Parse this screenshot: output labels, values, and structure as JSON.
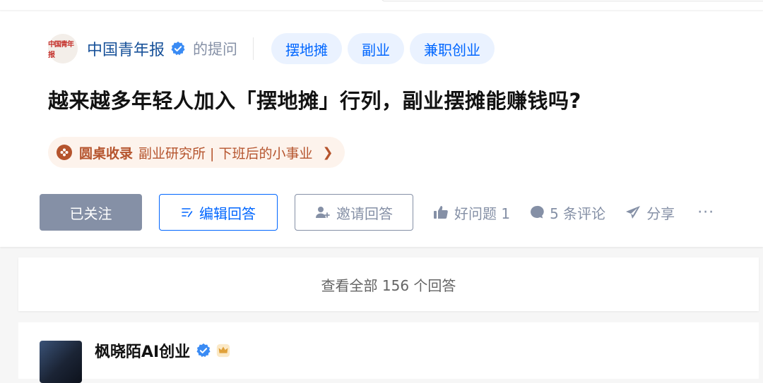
{
  "question": {
    "asker": {
      "avatar_text": "中国青年报",
      "name": "中国青年报",
      "suffix": "的提问"
    },
    "tags": [
      "摆地摊",
      "副业",
      "兼职创业"
    ],
    "title": "越来越多年轻人加入「摆地摊」行列，副业摆摊能赚钱吗?",
    "roundtable": {
      "label": "圆桌收录",
      "description": "副业研究所 | 下班后的小事业",
      "chevron": "❯"
    }
  },
  "actions": {
    "follow_label": "已关注",
    "edit_label": "编辑回答",
    "invite_label": "邀请回答",
    "good_question_label": "好问题 1",
    "comments_label": "5 条评论",
    "share_label": "分享",
    "more_label": "···"
  },
  "view_all_label": "查看全部 156 个回答",
  "answer": {
    "author": "枫晓陌AI创业"
  },
  "colors": {
    "brand_blue": "#0066ff",
    "link_blue": "#175199",
    "gray": "#8590a6",
    "roundtable_brown": "#b5542d"
  },
  "icons": [
    "verified-icon",
    "edit-icon",
    "invite-user-icon",
    "thumbs-up-icon",
    "comment-icon",
    "share-icon",
    "roundtable-icon",
    "crown-badge-icon"
  ]
}
